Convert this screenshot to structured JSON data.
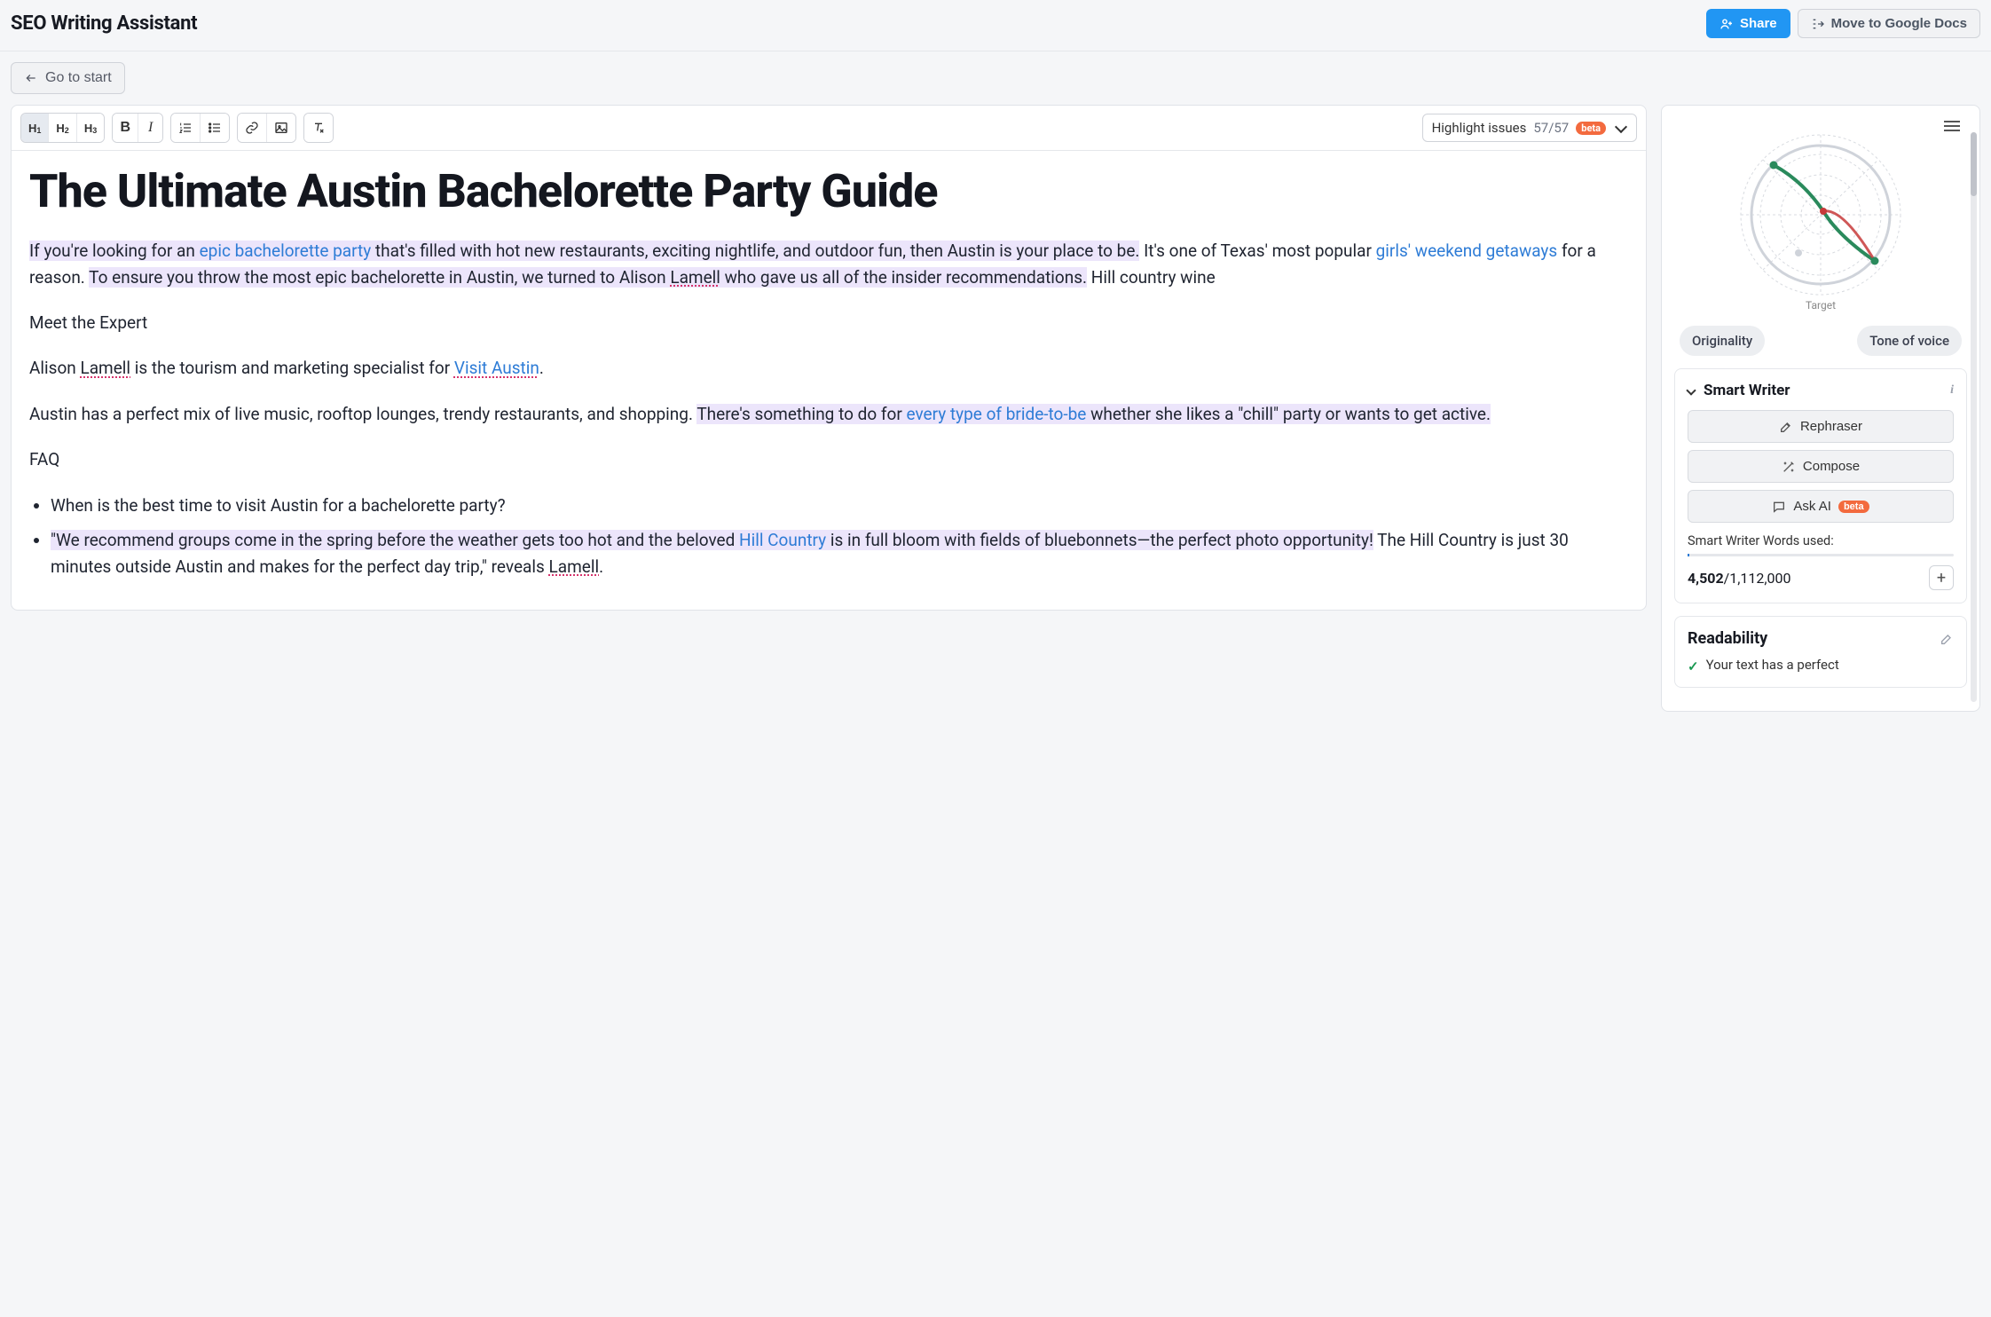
{
  "header": {
    "title": "SEO Writing Assistant",
    "share": "Share",
    "move": "Move to Google Docs"
  },
  "subbar": {
    "go_start": "Go to start"
  },
  "toolbar": {
    "h1": "H",
    "h1s": "1",
    "h2": "H",
    "h2s": "2",
    "h3": "H",
    "h3s": "3",
    "highlight_label": "Highlight issues",
    "highlight_count": "57/57",
    "beta": "beta"
  },
  "doc": {
    "title": "The Ultimate Austin Bachelorette Party Guide",
    "p1a": "If you're looking for an ",
    "p1b": "epic bachelorette party",
    "p1c": " that's filled with hot new restaurants, exciting nightlife, and outdoor fun, then Austin is your place to be.",
    "p1d": " It's one of Texas' most popular ",
    "p1e": "girls' weekend getaways",
    "p1f": " for a reason. ",
    "p1g": "To ensure you throw the most epic bachelorette in Austin, we turned to Alison ",
    "p1h": "Lamell",
    "p1i": " who gave us all of the insider recommendations.",
    "p1j": " Hill country wine",
    "p2": "Meet the Expert",
    "p3a": "Alison ",
    "p3b": "Lamell",
    "p3c": " is the tourism and marketing specialist for ",
    "p3d": "Visit Austin",
    "p3e": ".",
    "p4a": "Austin has a perfect mix of live music, rooftop lounges, trendy restaurants, and shopping. ",
    "p4b": "There's something to do for ",
    "p4c": "every type of bride-to-be",
    "p4d": " whether she likes a \"chill\" party or wants to get active.",
    "faq": "FAQ",
    "li1": "When is the best time to visit Austin for a bachelorette party?",
    "li2a": "\"We recommend groups come in the spring before the weather gets too hot and the beloved ",
    "li2b": "Hill Country",
    "li2c": " is in full bloom with fields of bluebonnets—the perfect photo opportunity!",
    "li2d": " The Hill Country is just 30 minutes outside Austin and makes for the perfect day trip,\" reveals ",
    "li2e": "Lamell",
    "li2f": "."
  },
  "side": {
    "target": "Target",
    "originality": "Originality",
    "tone": "Tone of voice",
    "smart_writer": "Smart Writer",
    "rephraser": "Rephraser",
    "compose": "Compose",
    "ask_ai": "Ask AI",
    "ask_beta": "beta",
    "usage_label": "Smart Writer Words used:",
    "usage_used": "4,502",
    "usage_sep": "/",
    "usage_total": "1,112,000",
    "readability": "Readability",
    "read_msg": "Your text has a perfect"
  }
}
